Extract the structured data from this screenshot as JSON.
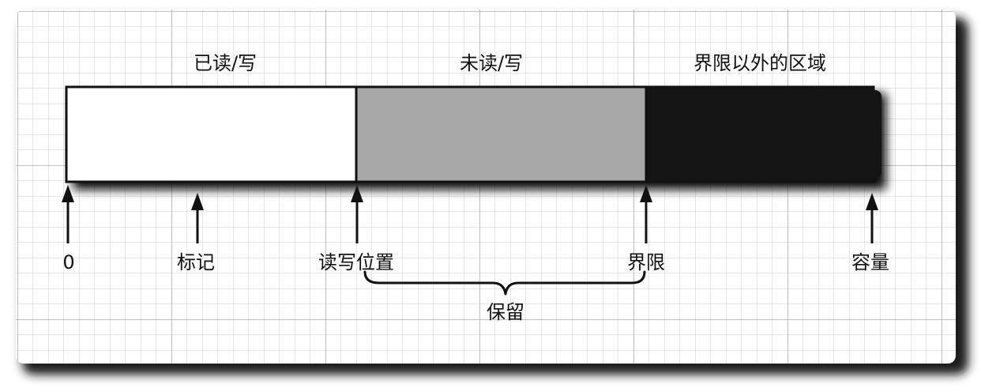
{
  "regions": {
    "read_write": "已读/写",
    "unread_write": "未读/写",
    "beyond_limit": "界限以外的区域"
  },
  "markers": {
    "zero": "0",
    "mark": "标记",
    "position": "读写位置",
    "limit": "界限",
    "capacity": "容量"
  },
  "brace": {
    "label": "保留"
  },
  "colors": {
    "read_write_fill": "#ffffff",
    "unread_write_fill": "#a8a8a8",
    "beyond_limit_fill": "#141414",
    "grid_line": "#c4c4c4",
    "paper": "#ffffff",
    "shadow": "#1a1a1a"
  }
}
